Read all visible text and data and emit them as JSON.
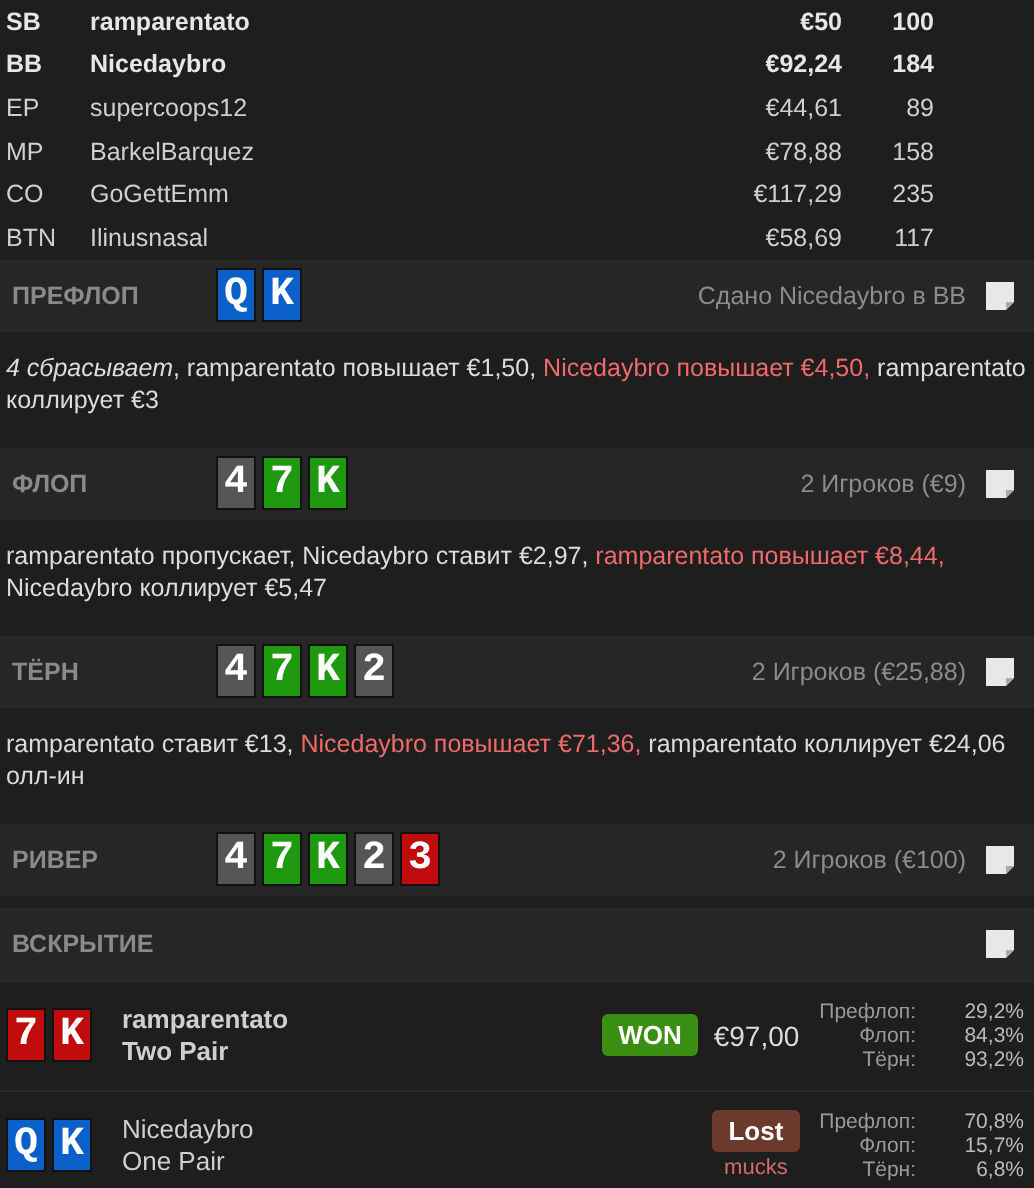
{
  "players": [
    {
      "position": "SB",
      "name": "ramparentato",
      "stack": "€50",
      "bb": "100",
      "involved": true
    },
    {
      "position": "BB",
      "name": "Nicedaybro",
      "stack": "€92,24",
      "bb": "184",
      "involved": true
    },
    {
      "position": "EP",
      "name": "supercoops12",
      "stack": "€44,61",
      "bb": "89",
      "involved": false
    },
    {
      "position": "MP",
      "name": "BarkelBarquez",
      "stack": "€78,88",
      "bb": "158",
      "involved": false
    },
    {
      "position": "CO",
      "name": "GoGettEmm",
      "stack": "€117,29",
      "bb": "235",
      "involved": false
    },
    {
      "position": "BTN",
      "name": "Ilinusnasal",
      "stack": "€58,69",
      "bb": "117",
      "involved": false
    }
  ],
  "streets": [
    {
      "title": "ПРЕФЛОП",
      "cards": [
        {
          "rank": "Q",
          "color": "#0a5fc8"
        },
        {
          "rank": "K",
          "color": "#0a5fc8"
        }
      ],
      "info": "Сдано Nicedaybro в BB",
      "actions": [
        {
          "text": "*4 сбрасывает*, ramparentato повышает €1,50, ",
          "highlight": false
        },
        {
          "text": "Nicedaybro повышает €4,50,",
          "highlight": true
        },
        {
          "text": " ramparentato коллирует €3",
          "highlight": false
        }
      ]
    },
    {
      "title": "ФЛОП",
      "cards": [
        {
          "rank": "4",
          "color": "#555555"
        },
        {
          "rank": "7",
          "color": "#1f9a10"
        },
        {
          "rank": "K",
          "color": "#1f9a10"
        }
      ],
      "info": "2 Игроков (€9)",
      "actions": [
        {
          "text": "ramparentato пропускает, Nicedaybro ставит €2,97, ",
          "highlight": false
        },
        {
          "text": "ramparentato повышает €8,44,",
          "highlight": true
        },
        {
          "text": " Nicedaybro коллирует €5,47",
          "highlight": false
        }
      ]
    },
    {
      "title": "ТЁРН",
      "cards": [
        {
          "rank": "4",
          "color": "#555555"
        },
        {
          "rank": "7",
          "color": "#1f9a10"
        },
        {
          "rank": "K",
          "color": "#1f9a10"
        },
        {
          "rank": "2",
          "color": "#555555"
        }
      ],
      "info": "2 Игроков (€25,88)",
      "actions": [
        {
          "text": "ramparentato ставит €13, ",
          "highlight": false
        },
        {
          "text": "Nicedaybro повышает €71,36,",
          "highlight": true
        },
        {
          "text": " ramparentato коллирует €24,06 олл-ин",
          "highlight": false
        }
      ]
    },
    {
      "title": "РИВЕР",
      "cards": [
        {
          "rank": "4",
          "color": "#555555"
        },
        {
          "rank": "7",
          "color": "#1f9a10"
        },
        {
          "rank": "K",
          "color": "#1f9a10"
        },
        {
          "rank": "2",
          "color": "#555555"
        },
        {
          "rank": "3",
          "color": "#c00c0c"
        }
      ],
      "info": "2 Игроков (€100)"
    }
  ],
  "showdown": {
    "title": "ВСКРЫТИЕ",
    "hands": [
      {
        "cards": [
          {
            "rank": "7",
            "color": "#c00c0c"
          },
          {
            "rank": "K",
            "color": "#c00c0c"
          }
        ],
        "name": "ramparentato",
        "hand": "Two Pair",
        "winner": true,
        "result": "WON",
        "amount": "€97,00",
        "equity": [
          {
            "label": "Префлоп:",
            "value": "29,2%"
          },
          {
            "label": "Флоп:",
            "value": "84,3%"
          },
          {
            "label": "Тёрн:",
            "value": "93,2%"
          }
        ]
      },
      {
        "cards": [
          {
            "rank": "Q",
            "color": "#0a5fc8"
          },
          {
            "rank": "K",
            "color": "#0a5fc8"
          }
        ],
        "name": "Nicedaybro",
        "hand": "One Pair",
        "winner": false,
        "result": "Lost",
        "note": "mucks",
        "equity": [
          {
            "label": "Префлоп:",
            "value": "70,8%"
          },
          {
            "label": "Флоп:",
            "value": "15,7%"
          },
          {
            "label": "Тёрн:",
            "value": "6,8%"
          }
        ]
      }
    ]
  }
}
